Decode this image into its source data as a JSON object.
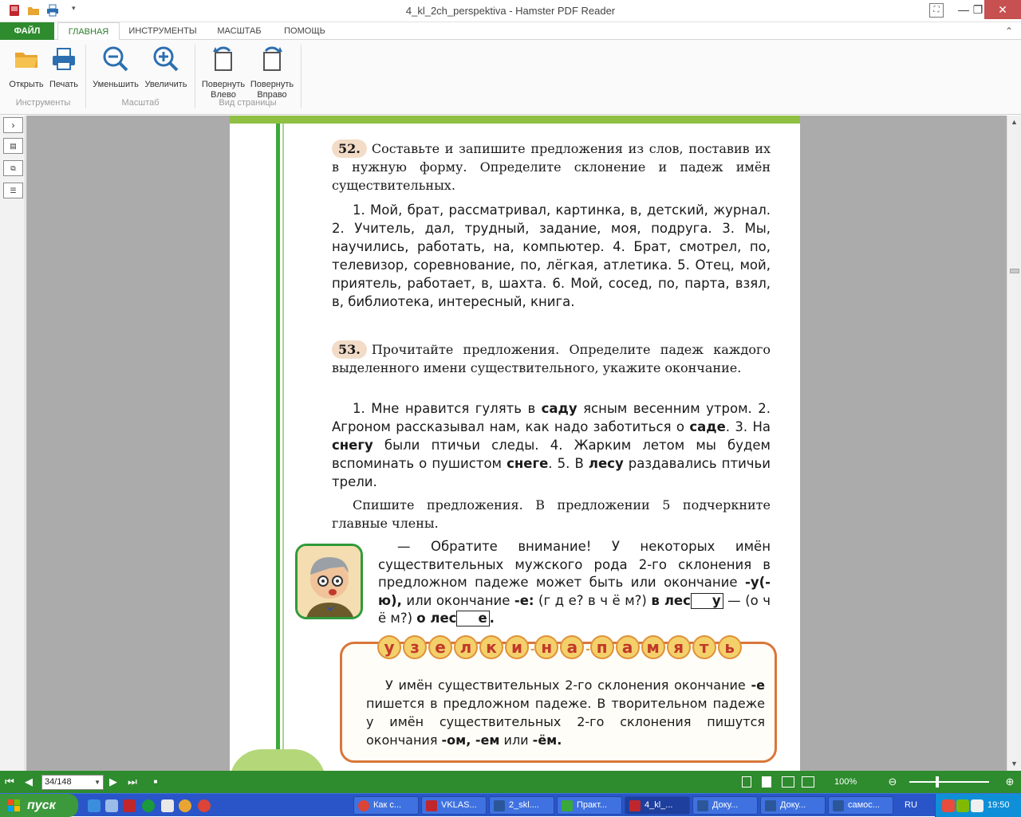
{
  "window": {
    "title": "4_kl_2ch_perspektiva - Hamster PDF Reader"
  },
  "tabs": [
    {
      "label": "ФАЙЛ"
    },
    {
      "label": "ГЛАВНАЯ"
    },
    {
      "label": "ИНСТРУМЕНТЫ"
    },
    {
      "label": "МАСШТАБ"
    },
    {
      "label": "ПОМОЩЬ"
    }
  ],
  "ribbon": {
    "open": "Открыть",
    "print": "Печать",
    "zoom_out": "Уменьшить",
    "zoom_in": "Увеличить",
    "rotate_left_1": "Повернуть",
    "rotate_left_2": "Влево",
    "rotate_right_1": "Повернуть",
    "rotate_right_2": "Вправо",
    "group_tools": "Инструменты",
    "group_zoom": "Масштаб",
    "group_view": "Вид страницы"
  },
  "doc": {
    "ex52_num": "52.",
    "ex52_task": "Составьте и запишите предложения из слов, поставив их в нужную форму. Определите склонение и падеж имён существительных.",
    "ex52_body": "1. Мой, брат, рассматривал, картинка, в, детский, журнал. 2. Учитель, дал, трудный, задание, моя, подруга. 3. Мы, научились, работать, на, компьютер. 4. Брат, смотрел, по, телевизор, соревнование, по, лёгкая, атлетика. 5. Отец, мой, приятель, работает, в, шахта. 6. Мой, сосед, по, парта, взял, в, библиотека, интересный, книга.",
    "ex53_num": "53.",
    "ex53_task": "Прочитайте предложения. Определите падеж каждого выделенного имени существительного, укажите окончание.",
    "ex53_s1a": "1. Мне нравится гулять в ",
    "ex53_w1": "саду",
    "ex53_s1b": " ясным весенним утром. 2. Агроном рассказывал нам, как надо заботиться о ",
    "ex53_w2": "саде",
    "ex53_s1c": ". 3. На ",
    "ex53_w3": "снегу",
    "ex53_s1d": " были птичьи следы. 4. Жарким летом мы будем вспоминать о пушистом ",
    "ex53_w4": "снеге",
    "ex53_s1e": ". 5. В ",
    "ex53_w5": "лесу",
    "ex53_s1f": " раздавались птичьи трели.",
    "ex53_task2": "Спишите предложения. В предложении 5 подчеркните главные члены.",
    "note_a": "— Обратите внимание! У некоторых имён существительных мужского рода 2-го склонения в предложном падеже может быть или окончание ",
    "note_b": "-у(-ю),",
    "note_c": " или окончание ",
    "note_d": "-е:",
    "note_e": " (г д е?  в  ч ё м?) ",
    "note_f": "в лес",
    "note_g": "у",
    "note_h": " — (о  ч  ё  м?) ",
    "note_i": "о лес",
    "note_j": "е",
    "note_k": ".",
    "memo_title": [
      "у",
      "з",
      "е",
      "л",
      "к",
      "и",
      "-",
      "н",
      "а",
      "-",
      "п",
      "а",
      "м",
      "я",
      "т",
      "ь"
    ],
    "memo_a": "У имён существительных 2-го склонения окончание ",
    "memo_b": "-е",
    "memo_c": " пишется в предложном падеже. В творительном падеже у имён существительных 2-го склонения пишутся окончания ",
    "memo_d": "-ом, -ем",
    "memo_e": " или ",
    "memo_f": "-ём."
  },
  "statusbar": {
    "page": "34/148",
    "zoom": "100%"
  },
  "taskbar": {
    "start": "пуск",
    "tasks": [
      "Как с...",
      "VKLAS...",
      "2_skl....",
      "Практ...",
      "4_kl_...",
      "Доку...",
      "Доку...",
      "самос..."
    ],
    "lang": "RU",
    "time": "19:50"
  },
  "colors": {
    "accent": "#2e8b2e",
    "taskbar": "#2a55c8"
  }
}
